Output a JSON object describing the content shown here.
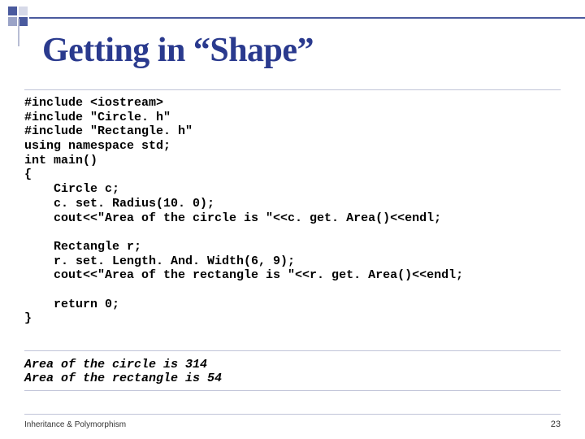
{
  "slide": {
    "title": "Getting in “Shape”",
    "code": "#include <iostream>\n#include \"Circle. h\"\n#include \"Rectangle. h\"\nusing namespace std;\nint main()\n{\n    Circle c;\n    c. set. Radius(10. 0);\n    cout<<\"Area of the circle is \"<<c. get. Area()<<endl;\n\n    Rectangle r;\n    r. set. Length. And. Width(6, 9);\n    cout<<\"Area of the rectangle is \"<<r. get. Area()<<endl;\n\n    return 0;\n}",
    "output": "Area of the circle is 314\nArea of the rectangle is 54",
    "footer_left": "Inheritance & Polymorphism",
    "footer_right": "23"
  }
}
